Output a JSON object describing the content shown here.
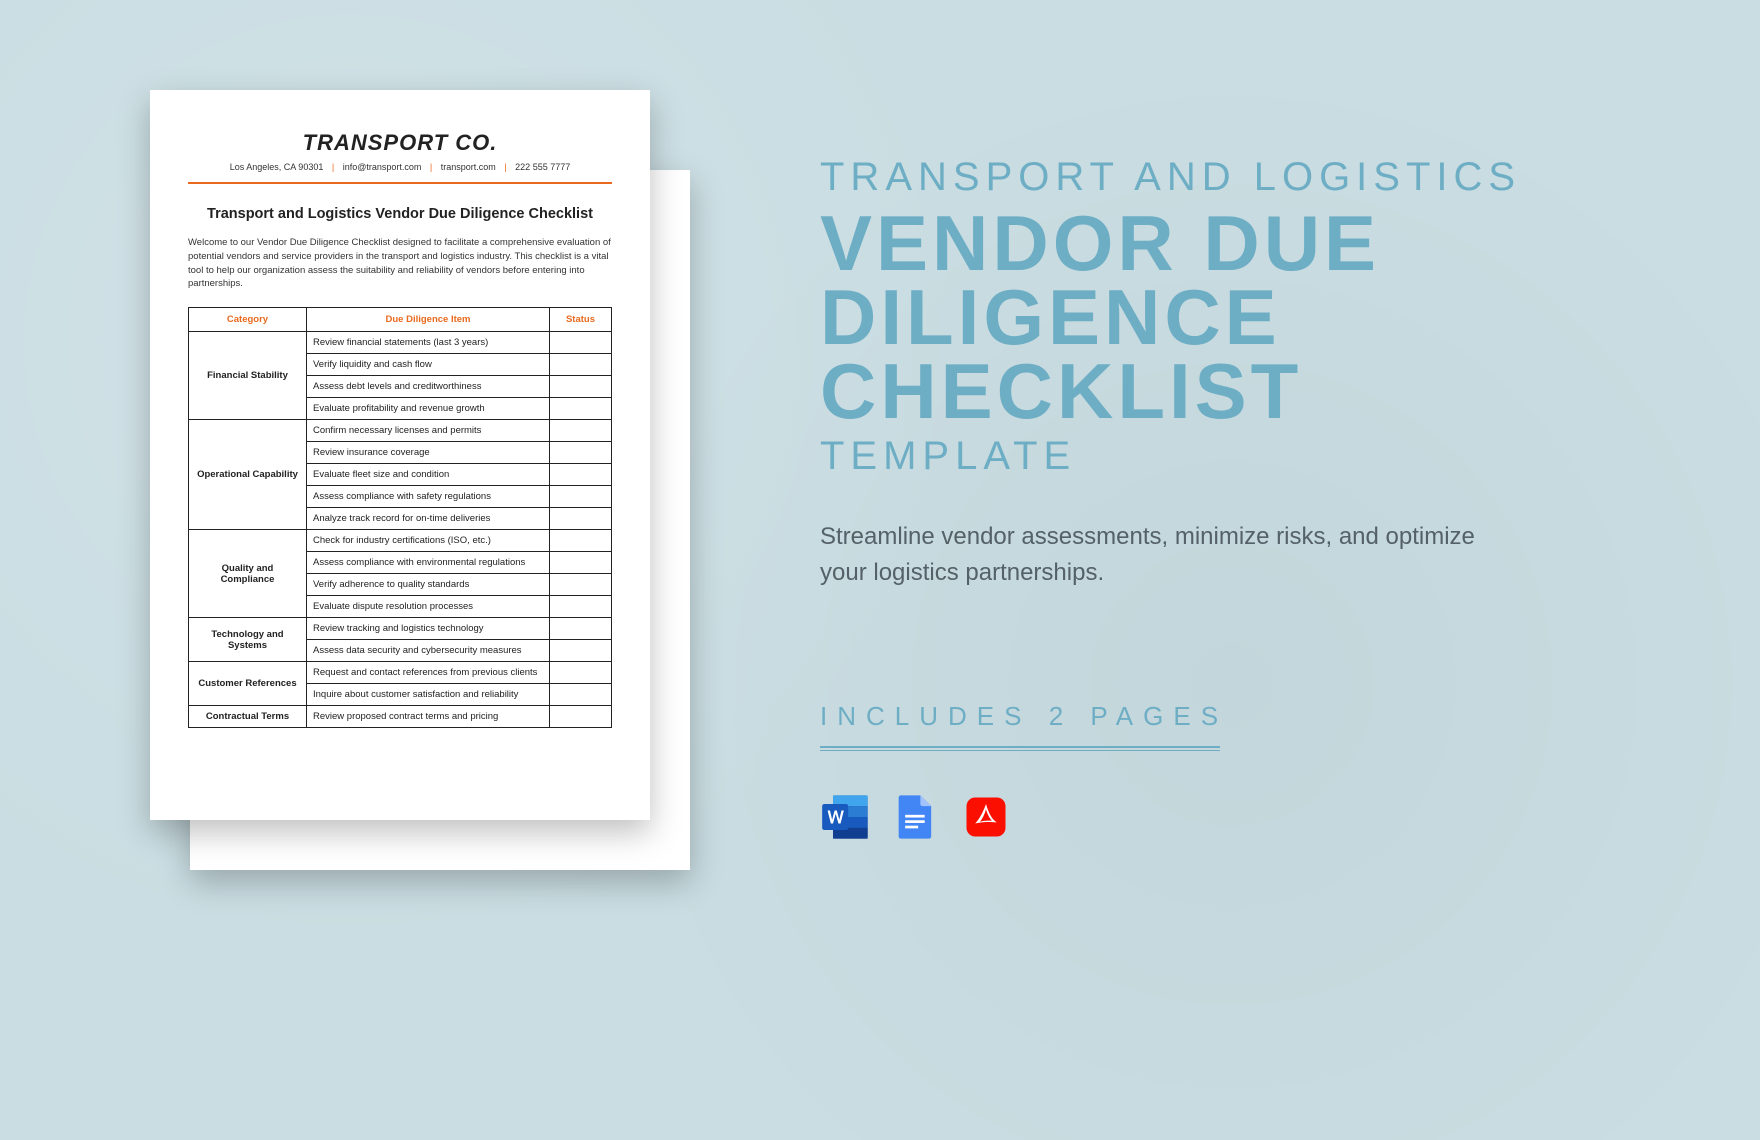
{
  "document": {
    "company": "TRANSPORT CO.",
    "contact": {
      "address": "Los Angeles, CA 90301",
      "email": "info@transport.com",
      "site": "transport.com",
      "phone": "222 555 7777"
    },
    "title": "Transport and Logistics Vendor Due Diligence Checklist",
    "intro": "Welcome to our Vendor Due Diligence Checklist designed to facilitate a comprehensive evaluation of potential vendors and service providers in the transport and logistics industry. This checklist is a vital tool to help our organization assess the suitability and reliability of vendors before entering into partnerships.",
    "columns": {
      "c0": "Category",
      "c1": "Due Diligence Item",
      "c2": "Status"
    },
    "categories": [
      {
        "name": "Financial Stability",
        "items": [
          "Review financial statements (last 3 years)",
          "Verify liquidity and cash flow",
          "Assess debt levels and creditworthiness",
          "Evaluate profitability and revenue growth"
        ]
      },
      {
        "name": "Operational Capability",
        "items": [
          "Confirm necessary licenses and permits",
          "Review insurance coverage",
          "Evaluate fleet size and condition",
          "Assess compliance with safety regulations",
          "Analyze track record for on-time deliveries"
        ]
      },
      {
        "name": "Quality and Compliance",
        "items": [
          "Check for industry certifications (ISO, etc.)",
          "Assess compliance with environmental regulations",
          "Verify adherence to quality standards",
          "Evaluate dispute resolution processes"
        ]
      },
      {
        "name": "Technology and Systems",
        "items": [
          "Review tracking and logistics technology",
          "Assess data security and cybersecurity measures"
        ]
      },
      {
        "name": "Customer References",
        "items": [
          "Request and contact references from previous clients",
          "Inquire about customer satisfaction and reliability"
        ]
      },
      {
        "name": "Contractual Terms",
        "items": [
          "Review proposed contract terms and pricing"
        ]
      }
    ]
  },
  "promo": {
    "eyebrow": "TRANSPORT AND LOGISTICS",
    "headline": "VENDOR DUE DILIGENCE CHECKLIST",
    "subhead": "TEMPLATE",
    "description": "Streamline vendor assessments, minimize risks, and optimize your logistics partnerships.",
    "includes": "INCLUDES 2 PAGES",
    "formats": [
      "word",
      "google-docs",
      "pdf"
    ]
  },
  "colors": {
    "accent": "#6eaec5",
    "orange": "#e96a1f"
  }
}
